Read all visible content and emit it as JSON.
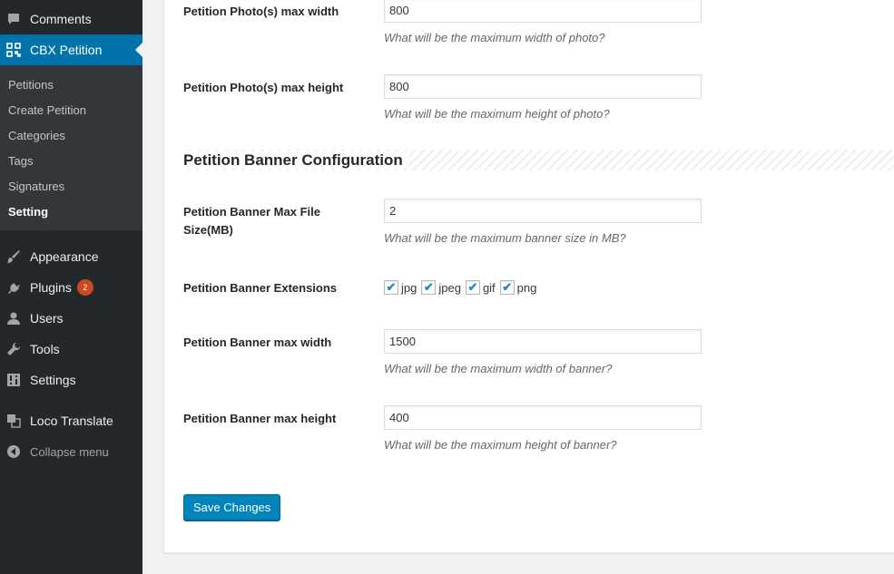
{
  "sidebar": {
    "comments": "Comments",
    "cbx_petition": "CBX Petition",
    "submenu": [
      "Petitions",
      "Create Petition",
      "Categories",
      "Tags",
      "Signatures",
      "Setting"
    ],
    "appearance": "Appearance",
    "plugins": "Plugins",
    "plugins_badge": "2",
    "users": "Users",
    "tools": "Tools",
    "settings": "Settings",
    "loco_translate": "Loco Translate",
    "collapse": "Collapse menu"
  },
  "form": {
    "photo_width": {
      "label": "Petition Photo(s) max width",
      "value": "800",
      "desc": "What will be the maximum width of photo?"
    },
    "photo_height": {
      "label": "Petition Photo(s) max height",
      "value": "800",
      "desc": "What will be the maximum height of photo?"
    },
    "banner_section": "Petition Banner Configuration",
    "banner_size": {
      "label_line1": "Petition Banner Max File",
      "label_line2": "Size(MB)",
      "value": "2",
      "desc": "What will be the maximum banner size in MB?"
    },
    "banner_ext": {
      "label": "Petition Banner Extensions",
      "options": [
        "jpg",
        "jpeg",
        "gif",
        "png"
      ]
    },
    "banner_width": {
      "label": "Petition Banner max width",
      "value": "1500",
      "desc": "What will be the maximum width of banner?"
    },
    "banner_height": {
      "label": "Petition Banner max height",
      "value": "400",
      "desc": "What will be the maximum height of banner?"
    },
    "save_label": "Save Changes"
  },
  "colors": {
    "sidebar_bg": "#23282d",
    "active_bg": "#0073aa",
    "button_bg": "#0085ba",
    "badge_bg": "#ca4a1f"
  }
}
